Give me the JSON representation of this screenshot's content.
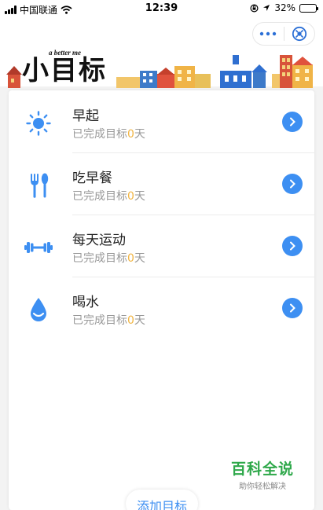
{
  "status_bar": {
    "carrier": "中国联通",
    "time": "12:39",
    "battery": "32%",
    "battery_level": 0.32
  },
  "header": {
    "logo_small": "a better me",
    "logo_big": "小目标"
  },
  "goals": [
    {
      "title": "早起",
      "done_prefix": "已完成目标",
      "done_count": "0",
      "done_suffix": "天",
      "icon": "sun-icon"
    },
    {
      "title": "吃早餐",
      "done_prefix": "已完成目标",
      "done_count": "0",
      "done_suffix": "天",
      "icon": "fork-spoon-icon"
    },
    {
      "title": "每天运动",
      "done_prefix": "已完成目标",
      "done_count": "0",
      "done_suffix": "天",
      "icon": "dumbbell-icon"
    },
    {
      "title": "喝水",
      "done_prefix": "已完成目标",
      "done_count": "0",
      "done_suffix": "天",
      "icon": "water-drop-icon"
    }
  ],
  "watermark": {
    "title": "百科全说",
    "subtitle": "助你轻松解决"
  },
  "add_button": "添加目标",
  "colors": {
    "accent": "#3d8ff2",
    "count": "#f1b543",
    "watermark": "#2ea84a"
  }
}
